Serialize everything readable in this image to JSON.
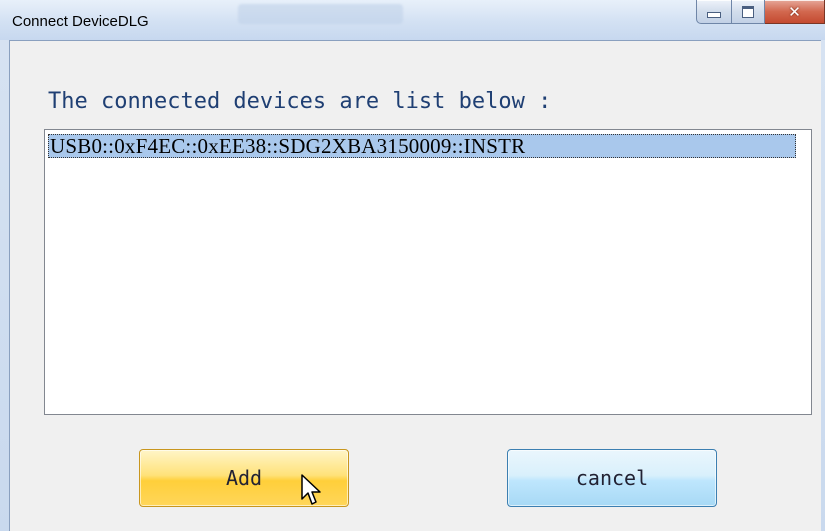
{
  "window": {
    "title": "Connect DeviceDLG"
  },
  "dialog": {
    "prompt": "The connected devices are list below :",
    "devices": [
      "USB0::0xF4EC::0xEE38::SDG2XBA3150009::INSTR"
    ],
    "selected_index": 0
  },
  "buttons": {
    "add_label": "Add",
    "cancel_label": "cancel"
  },
  "icons": {
    "minimize": "minimize-icon",
    "maximize": "maximize-icon",
    "close": "close-icon",
    "cursor": "mouse-pointer-icon"
  },
  "colors": {
    "selection": "#a9c8ec",
    "prompt_text": "#1f3f73",
    "add_button": "#ffd65a",
    "cancel_button": "#bee6fd",
    "close_button": "#c44a30"
  }
}
